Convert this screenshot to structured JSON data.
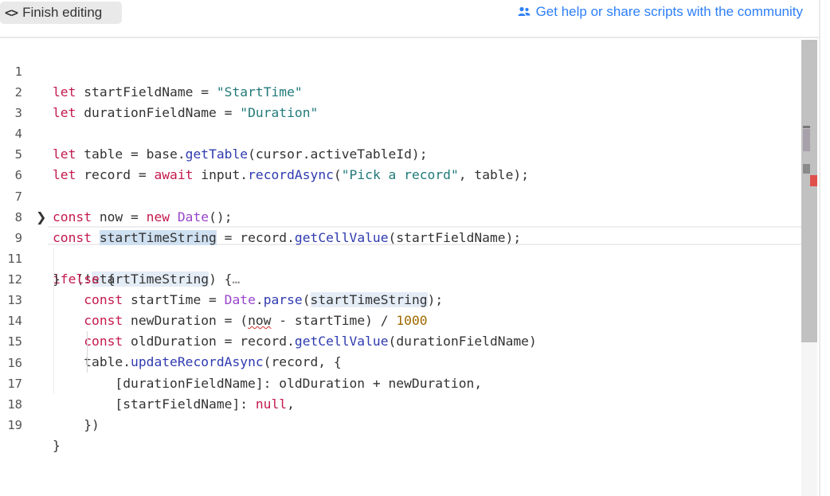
{
  "toolbar": {
    "finish_icon": "<>",
    "finish_label": "Finish editing",
    "help_label": "Get help or share scripts with the community"
  },
  "editor": {
    "lines": [
      {
        "n": "1"
      },
      {
        "n": "2"
      },
      {
        "n": "3"
      },
      {
        "n": "4"
      },
      {
        "n": "5"
      },
      {
        "n": "6"
      },
      {
        "n": "7"
      },
      {
        "n": "8"
      },
      {
        "n": "9"
      },
      {
        "n": "11"
      },
      {
        "n": "12"
      },
      {
        "n": "13"
      },
      {
        "n": "14"
      },
      {
        "n": "15"
      },
      {
        "n": "16"
      },
      {
        "n": "17"
      },
      {
        "n": "18"
      },
      {
        "n": "19"
      }
    ],
    "fold_marker": "…",
    "folded_line": "9"
  },
  "colors": {
    "accent": "#2d7ff9",
    "keyword": "#c41a4d",
    "string": "#227a7a",
    "function": "#2f3bb0",
    "number": "#a06a00"
  }
}
